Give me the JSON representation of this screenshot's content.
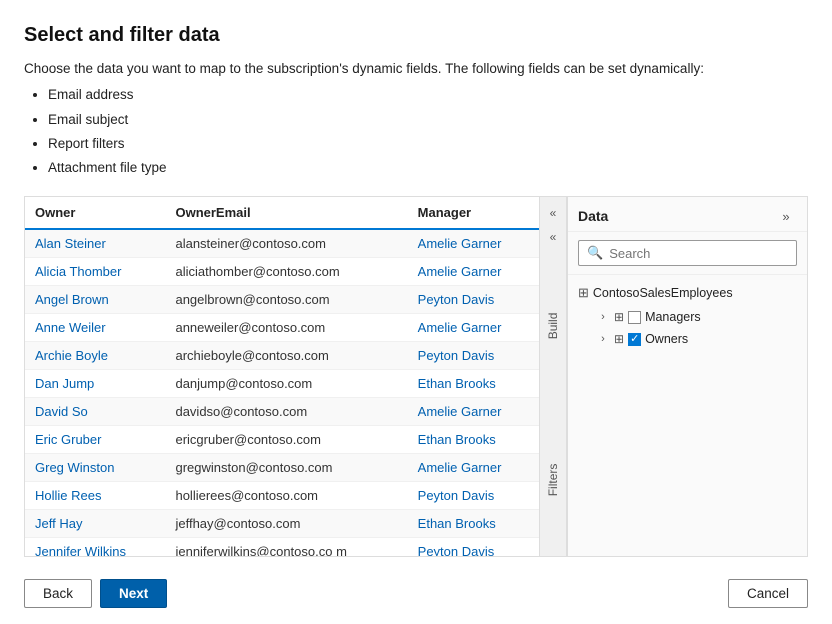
{
  "page": {
    "title": "Select and filter data",
    "description": "Choose the data you want to map to the subscription's dynamic fields. The following fields can be set dynamically:",
    "bullets": [
      "Email address",
      "Email subject",
      "Report filters",
      "Attachment file type"
    ]
  },
  "table": {
    "columns": [
      "Owner",
      "OwnerEmail",
      "Manager"
    ],
    "rows": [
      {
        "owner": "Alan Steiner",
        "email": "alansteiner@contoso.com",
        "manager": "Amelie Garner"
      },
      {
        "owner": "Alicia Thomber",
        "email": "aliciathomber@contoso.com",
        "manager": "Amelie Garner"
      },
      {
        "owner": "Angel Brown",
        "email": "angelbrown@contoso.com",
        "manager": "Peyton Davis"
      },
      {
        "owner": "Anne Weiler",
        "email": "anneweiler@contoso.com",
        "manager": "Amelie Garner"
      },
      {
        "owner": "Archie Boyle",
        "email": "archieboyle@contoso.com",
        "manager": "Peyton Davis"
      },
      {
        "owner": "Dan Jump",
        "email": "danjump@contoso.com",
        "manager": "Ethan Brooks"
      },
      {
        "owner": "David So",
        "email": "davidso@contoso.com",
        "manager": "Amelie Garner"
      },
      {
        "owner": "Eric Gruber",
        "email": "ericgruber@contoso.com",
        "manager": "Ethan Brooks"
      },
      {
        "owner": "Greg Winston",
        "email": "gregwinston@contoso.com",
        "manager": "Amelie Garner"
      },
      {
        "owner": "Hollie Rees",
        "email": "hollierees@contoso.com",
        "manager": "Peyton Davis"
      },
      {
        "owner": "Jeff Hay",
        "email": "jeffhay@contoso.com",
        "manager": "Ethan Brooks"
      },
      {
        "owner": "Jennifer Wilkins",
        "email": "jenniferwilkins@contoso.co\nm",
        "manager": "Peyton Davis"
      }
    ]
  },
  "tabs": {
    "build": "Build",
    "filters": "Filters"
  },
  "right_panel": {
    "title": "Data",
    "search_placeholder": "Search",
    "datasource": "ContosoSalesEmployees",
    "tree_items": [
      {
        "label": "Managers",
        "checked": false
      },
      {
        "label": "Owners",
        "checked": true
      }
    ]
  },
  "footer": {
    "back_label": "Back",
    "next_label": "Next",
    "cancel_label": "Cancel"
  }
}
